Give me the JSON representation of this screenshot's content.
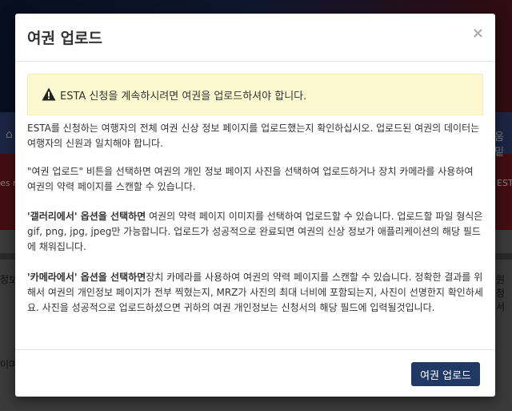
{
  "background": {
    "fragments": [
      "움밑",
      "es r",
      "EST",
      "정보",
      "원청서",
      "이며"
    ]
  },
  "modal": {
    "title": "여권 업로드",
    "close_label": "×",
    "alert_text": "ESTA 신청을 계속하시려면 여권을 업로드하셔야 합니다.",
    "para1": "ESTA를 신청하는 여행자의 전체 여권 신상 정보 페이지를 업로드했는지 확인하십시오.  업로드된 여권의 데이터는 여행자의 신원과 일치해야 합니다.",
    "para2": "\"여권 업로드\" 비튼을 선택하면 여권의 개인 정보 페이지 사진을 선택하여 업로드하거나 장치 카메라를 사용하여 여권의 약력 페이지를 스캔할 수 있습니다.",
    "para3_bold": "'갤러리에서' 옵션을 선택하면",
    "para3_rest": " 여권의 약력 페이지 이미지를 선택하여 업로드할 수 있습니다. 업로드할 파일 형식은 gif, png, jpg, jpeg만 가능합니다. 업로드가 성공적으로 완료되면 여권의 신상 정보가 애플리케이션의 해당 필드에 채워집니다.",
    "para4_bold": "'카메라에서' 옵션을 선택하면",
    "para4_rest": "장치 카메라를 사용하여 여권의 약력 페이지를 스캔할 수 있습니다. 정확한 결과를 위해서 여권의 개인정보 페이지가 전부 찍혔는지, MRZ가 사진의 최대 너비에 포함되는지, 사진이 선명한지 확인하세요. 사진을 성공적으로 업로드하셨으면 귀하의 여권 개인정보는 신청서의 해당 필드에 입력될것입니다.",
    "upload_button": "여권 업로드"
  },
  "colors": {
    "alert_bg": "#fcf8cf",
    "button_bg": "#1f3864"
  }
}
